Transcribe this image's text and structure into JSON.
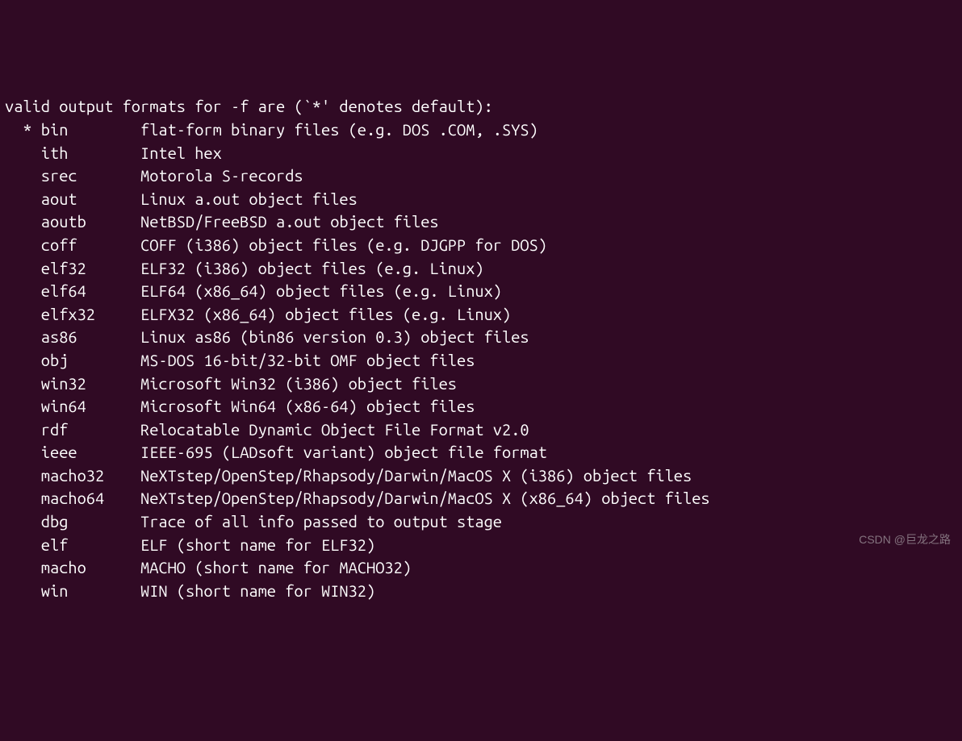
{
  "header": "valid output formats for -f are (`*' denotes default):",
  "formats": [
    {
      "default": true,
      "name": "bin",
      "desc": "flat-form binary files (e.g. DOS .COM, .SYS)"
    },
    {
      "default": false,
      "name": "ith",
      "desc": "Intel hex"
    },
    {
      "default": false,
      "name": "srec",
      "desc": "Motorola S-records"
    },
    {
      "default": false,
      "name": "aout",
      "desc": "Linux a.out object files"
    },
    {
      "default": false,
      "name": "aoutb",
      "desc": "NetBSD/FreeBSD a.out object files"
    },
    {
      "default": false,
      "name": "coff",
      "desc": "COFF (i386) object files (e.g. DJGPP for DOS)"
    },
    {
      "default": false,
      "name": "elf32",
      "desc": "ELF32 (i386) object files (e.g. Linux)"
    },
    {
      "default": false,
      "name": "elf64",
      "desc": "ELF64 (x86_64) object files (e.g. Linux)"
    },
    {
      "default": false,
      "name": "elfx32",
      "desc": "ELFX32 (x86_64) object files (e.g. Linux)"
    },
    {
      "default": false,
      "name": "as86",
      "desc": "Linux as86 (bin86 version 0.3) object files"
    },
    {
      "default": false,
      "name": "obj",
      "desc": "MS-DOS 16-bit/32-bit OMF object files"
    },
    {
      "default": false,
      "name": "win32",
      "desc": "Microsoft Win32 (i386) object files"
    },
    {
      "default": false,
      "name": "win64",
      "desc": "Microsoft Win64 (x86-64) object files"
    },
    {
      "default": false,
      "name": "rdf",
      "desc": "Relocatable Dynamic Object File Format v2.0"
    },
    {
      "default": false,
      "name": "ieee",
      "desc": "IEEE-695 (LADsoft variant) object file format"
    },
    {
      "default": false,
      "name": "macho32",
      "desc": "NeXTstep/OpenStep/Rhapsody/Darwin/MacOS X (i386) object files"
    },
    {
      "default": false,
      "name": "macho64",
      "desc": "NeXTstep/OpenStep/Rhapsody/Darwin/MacOS X (x86_64) object files"
    },
    {
      "default": false,
      "name": "dbg",
      "desc": "Trace of all info passed to output stage"
    },
    {
      "default": false,
      "name": "elf",
      "desc": "ELF (short name for ELF32)"
    },
    {
      "default": false,
      "name": "macho",
      "desc": "MACHO (short name for MACHO32)"
    },
    {
      "default": false,
      "name": "win",
      "desc": "WIN (short name for WIN32)"
    }
  ],
  "watermark": "CSDN @巨龙之路"
}
